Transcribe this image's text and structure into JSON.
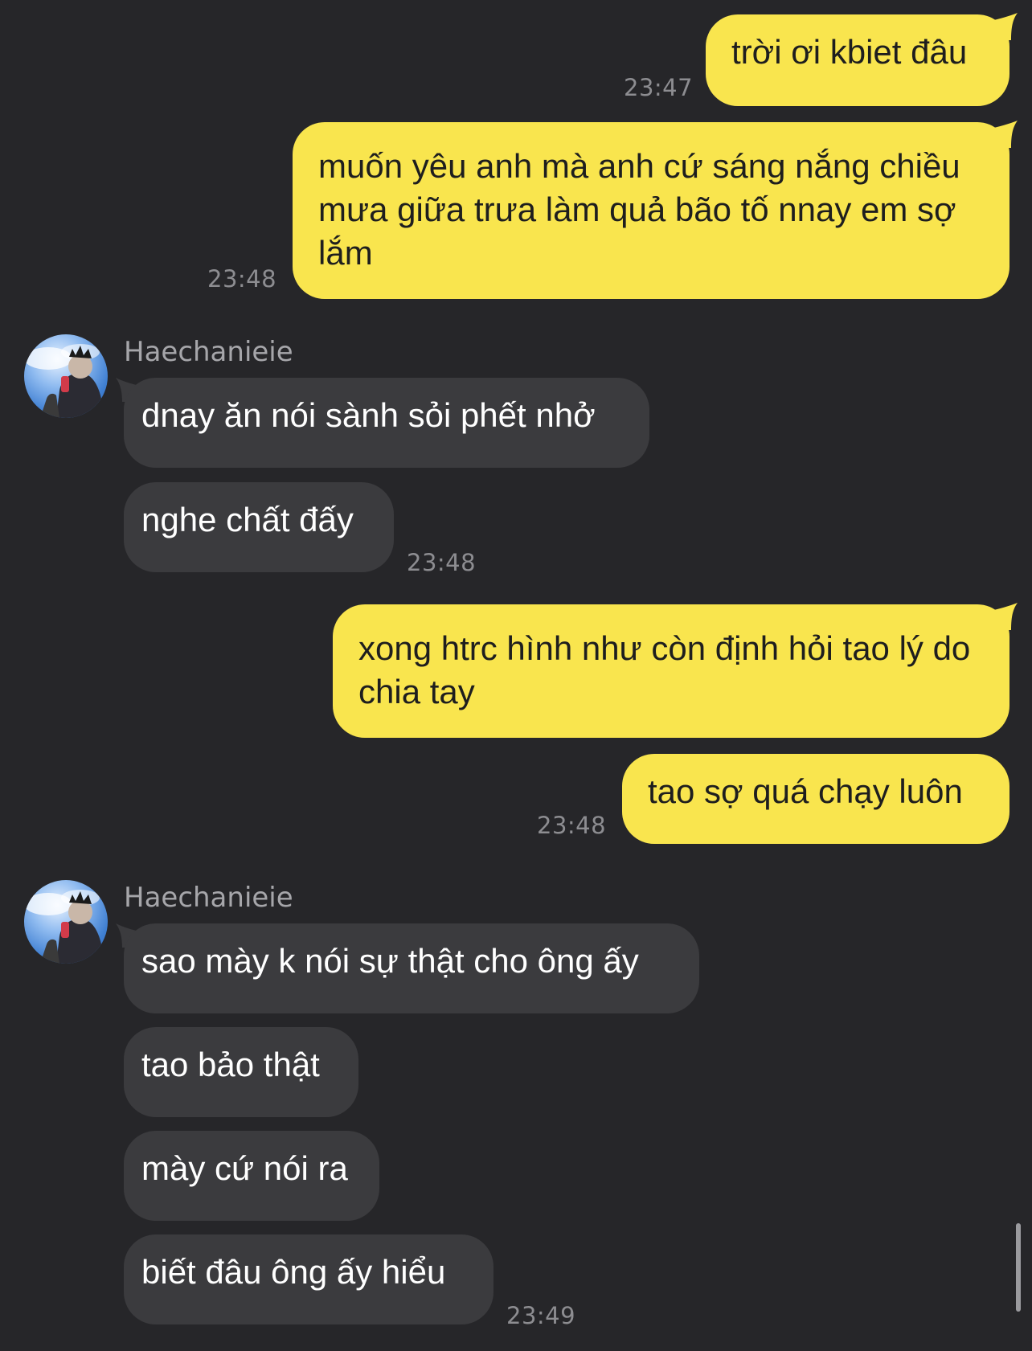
{
  "conversation": {
    "contact_name": "Haechanieie",
    "messages": [
      {
        "id": "m1",
        "direction": "outgoing",
        "text": "trời ơi kbiet đâu",
        "time": "23:47"
      },
      {
        "id": "m2",
        "direction": "outgoing",
        "text": "muốn yêu anh mà anh cứ sáng nắng chiều mưa giữa trưa làm quả bão tố nnay em sợ lắm",
        "time": "23:48"
      },
      {
        "id": "m3",
        "direction": "incoming",
        "sender": "Haechanieie",
        "text": "dnay ăn nói sành sỏi phết nhở"
      },
      {
        "id": "m4",
        "direction": "incoming",
        "text": "nghe chất đấy",
        "time": "23:48"
      },
      {
        "id": "m5",
        "direction": "outgoing",
        "text": "xong htrc hình như còn định hỏi tao lý do chia tay"
      },
      {
        "id": "m6",
        "direction": "outgoing",
        "text": "tao sợ quá chạy luôn",
        "time": "23:48"
      },
      {
        "id": "m7",
        "direction": "incoming",
        "sender": "Haechanieie",
        "text": "sao mày k nói sự thật cho ông ấy"
      },
      {
        "id": "m8",
        "direction": "incoming",
        "text": "tao bảo thật"
      },
      {
        "id": "m9",
        "direction": "incoming",
        "text": "mày cứ nói ra"
      },
      {
        "id": "m10",
        "direction": "incoming",
        "text": "biết đâu ông ấy hiểu",
        "time": "23:49"
      }
    ]
  },
  "colors": {
    "background": "#262629",
    "outgoing_bubble": "#f9e54e",
    "incoming_bubble": "#3b3b3e",
    "timestamp": "#8d8d91",
    "sender_name": "#a6a6aa"
  },
  "icons": {
    "avatar": "contact-avatar-photo"
  }
}
